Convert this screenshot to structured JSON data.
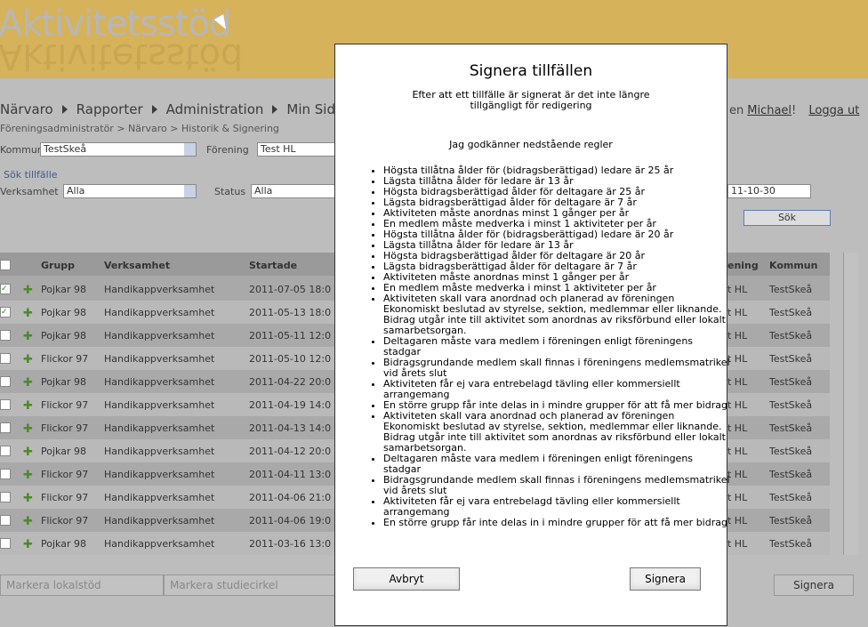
{
  "app": {
    "title": "Aktivitetsstöd"
  },
  "nav": [
    "Närvaro",
    "Rapporter",
    "Administration",
    "Min Sida"
  ],
  "breadcrumb": "Föreningsadministratör > Närvaro > Historik & Signering",
  "user": {
    "greeting": "en",
    "name": "Michael",
    "punct": "!",
    "logout": "Logga ut"
  },
  "filters": {
    "kommun_label": "Kommun",
    "kommun_value": "TestSkeå",
    "forening_label": "Förening",
    "forening_value": "Test HL",
    "sok_title": "Sök tillfälle",
    "verksamhet_label": "Verksamhet",
    "verksamhet_value": "Alla",
    "status_label": "Status",
    "status_value": "Alla",
    "date_value": "11-10-30",
    "sok_button": "Sök"
  },
  "grid": {
    "headers": {
      "grupp": "Grupp",
      "verksamhet": "Verksamhet",
      "startade": "Startade",
      "forening": "ening",
      "kommun": "Kommun"
    },
    "rows": [
      {
        "checked": true,
        "grupp": "Pojkar 98",
        "verksamhet": "Handikappverksamhet",
        "start": "2011-07-05 18:0",
        "forening": "t HL",
        "kommun": "TestSkeå"
      },
      {
        "checked": true,
        "grupp": "Pojkar 98",
        "verksamhet": "Handikappverksamhet",
        "start": "2011-05-13 18:0",
        "forening": "t HL",
        "kommun": "TestSkeå"
      },
      {
        "checked": false,
        "grupp": "Pojkar 98",
        "verksamhet": "Handikappverksamhet",
        "start": "2011-05-11 12:0",
        "forening": "t HL",
        "kommun": "TestSkeå"
      },
      {
        "checked": false,
        "grupp": "Flickor 97",
        "verksamhet": "Handikappverksamhet",
        "start": "2011-05-10 12:0",
        "forening": "t HL",
        "kommun": "TestSkeå"
      },
      {
        "checked": false,
        "grupp": "Pojkar 98",
        "verksamhet": "Handikappverksamhet",
        "start": "2011-04-22 20:0",
        "forening": "t HL",
        "kommun": "TestSkeå"
      },
      {
        "checked": false,
        "grupp": "Flickor 97",
        "verksamhet": "Handikappverksamhet",
        "start": "2011-04-19 14:0",
        "forening": "t HL",
        "kommun": "TestSkeå"
      },
      {
        "checked": false,
        "grupp": "Flickor 97",
        "verksamhet": "Handikappverksamhet",
        "start": "2011-04-13 14:0",
        "forening": "t HL",
        "kommun": "TestSkeå"
      },
      {
        "checked": false,
        "grupp": "Pojkar 98",
        "verksamhet": "Handikappverksamhet",
        "start": "2011-04-12 20:0",
        "forening": "t HL",
        "kommun": "TestSkeå"
      },
      {
        "checked": false,
        "grupp": "Flickor 97",
        "verksamhet": "Handikappverksamhet",
        "start": "2011-04-11 13:0",
        "forening": "t HL",
        "kommun": "TestSkeå"
      },
      {
        "checked": false,
        "grupp": "Flickor 97",
        "verksamhet": "Handikappverksamhet",
        "start": "2011-04-06 21:0",
        "forening": "t HL",
        "kommun": "TestSkeå"
      },
      {
        "checked": false,
        "grupp": "Flickor 97",
        "verksamhet": "Handikappverksamhet",
        "start": "2011-04-06 19:0",
        "forening": "t HL",
        "kommun": "TestSkeå"
      },
      {
        "checked": false,
        "grupp": "Pojkar 98",
        "verksamhet": "Handikappverksamhet",
        "start": "2011-03-16 13:0",
        "forening": "t HL",
        "kommun": "TestSkeå"
      }
    ]
  },
  "footer": {
    "markera_lokal": "Markera lokalstöd",
    "markera_studie": "Markera studiecirkel",
    "signera": "Signera"
  },
  "modal": {
    "title": "Signera tillfällen",
    "subtitle": "Efter att ett tillfälle är signerat är det inte längre tillgängligt för redigering",
    "agree": "Jag godkänner nedstående regler",
    "rules": [
      "Högsta tillåtna ålder för (bidragsberättigad) ledare är 25 år",
      "Lägsta tillåtna ålder för ledare är 13 år",
      "Högsta bidragsberättigad ålder för deltagare är 25 år",
      "Lägsta bidragsberättigad ålder för deltagare är 7 år",
      "Aktiviteten måste anordnas minst 1 gånger per år",
      "En medlem måste medverka i minst 1 aktiviteter per år",
      "Högsta tillåtna ålder för (bidragsberättigad) ledare är 20 år",
      "Lägsta tillåtna ålder för ledare är 13 år",
      "Högsta bidragsberättigad ålder för deltagare är 20 år",
      "Lägsta bidragsberättigad ålder för deltagare är 7 år",
      "Aktiviteten måste anordnas minst 1 gånger per år",
      "En medlem måste medverka i minst 1 aktiviteter per år",
      "Aktiviteten skall vara anordnad och planerad av föreningen Ekonomiskt beslutad av styrelse, sektion, medlemmar eller liknande. Bidrag utgår inte till aktivitet som anordnas av riksförbund eller lokalt samarbetsorgan.",
      "Deltagaren måste vara medlem i föreningen enligt föreningens stadgar",
      "Bidragsgrundande medlem skall finnas i föreningens medlemsmatrikel vid årets slut",
      "Aktiviteten får ej vara entrebelagd tävling eller kommersiellt arrangemang",
      "En större grupp får inte delas in i mindre grupper för att få mer bidrag",
      "Aktiviteten skall vara anordnad och planerad av föreningen Ekonomiskt beslutad av styrelse, sektion, medlemmar eller liknande. Bidrag utgår inte till aktivitet som anordnas av riksförbund eller lokalt samarbetsorgan.",
      "Deltagaren måste vara medlem i föreningen enligt föreningens stadgar",
      "Bidragsgrundande medlem skall finnas i föreningens medlemsmatrikel vid årets slut",
      "Aktiviteten får ej vara entrebelagd tävling eller kommersiellt arrangemang",
      "En större grupp får inte delas in i mindre grupper för att få mer bidrag"
    ],
    "cancel": "Avbryt",
    "sign": "Signera"
  }
}
